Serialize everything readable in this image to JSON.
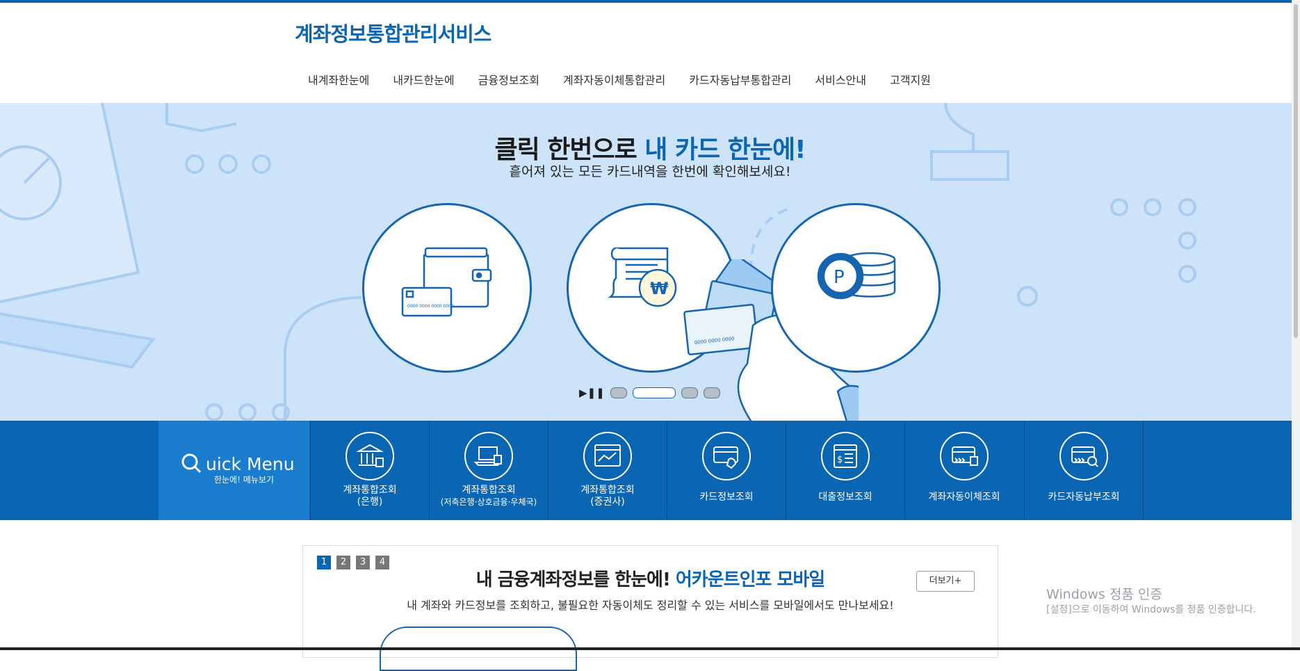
{
  "header": {
    "logo": "계좌정보통합관리서비스",
    "nav": [
      "내계좌한눈에",
      "내카드한눈에",
      "금융정보조회",
      "계좌자동이체통합관리",
      "카드자동납부통합관리",
      "서비스안내",
      "고객지원"
    ]
  },
  "hero": {
    "title_plain": "클릭 한번으로 ",
    "title_highlight": "내 카드 한눈에!",
    "subtitle": "흩어져 있는 모든 카드내역을 한번에 확인해보세요!",
    "slides_total": 4,
    "slide_active": 2,
    "card_number_1": "0000 0000 0000 0000",
    "card_number_2": "0000 0000 0000",
    "point_symbol": "P",
    "won_symbol": "₩"
  },
  "quick_menu": {
    "title_big": "uick Menu",
    "title_small": "한눈에! 메뉴보기",
    "items": [
      {
        "line1": "계좌통합조회",
        "line2": "(은행)",
        "icon": "bank-icon"
      },
      {
        "line1": "계좌통합조회",
        "line2": "(저축은행·상호금융·우체국)",
        "icon": "laptop-icon"
      },
      {
        "line1": "계좌통합조회",
        "line2": "(증권사)",
        "icon": "chart-screen-icon"
      },
      {
        "line1": "카드정보조회",
        "line2": "",
        "icon": "card-hand-icon"
      },
      {
        "line1": "대출정보조회",
        "line2": "",
        "icon": "loan-document-icon"
      },
      {
        "line1": "계좌자동이체조회",
        "line2": "",
        "icon": "auto-transfer-icon"
      },
      {
        "line1": "카드자동납부조회",
        "line2": "",
        "icon": "card-search-icon"
      }
    ]
  },
  "panel": {
    "pages": [
      "1",
      "2",
      "3",
      "4"
    ],
    "title_plain": "내 금융계좌정보를 한눈에! ",
    "title_highlight": "어카운트인포 모바일",
    "subtitle": "내 계좌와 카드정보를 조회하고, 불필요한 자동이체도 정리할 수 있는 서비스를 모바일에서도 만나보세요!",
    "more_label": "더보기+"
  },
  "watermark": {
    "line1": "Windows 정품 인증",
    "line2": "[설정]으로 이동하여 Windows를 정품 인증합니다."
  },
  "colors": {
    "brand": "#0a66b2",
    "hero_bg": "#cde3fa",
    "quick_bg": "#0a66b2"
  }
}
